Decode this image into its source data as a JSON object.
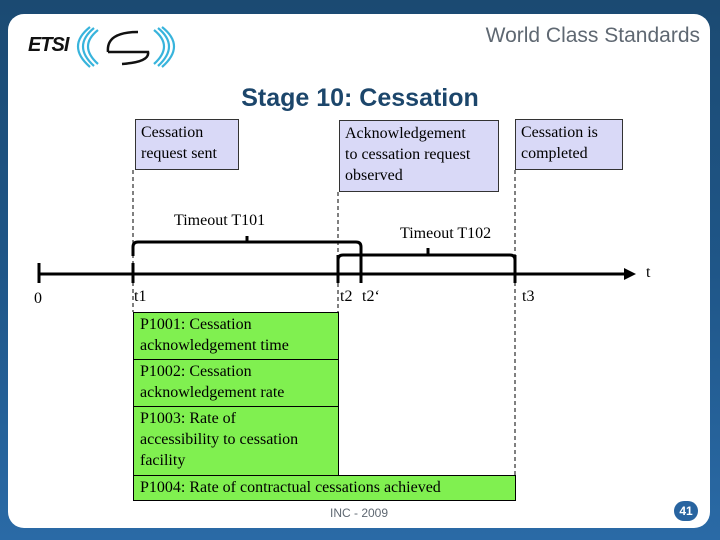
{
  "header": {
    "logo_text": "ETSI",
    "tagline": "World Class Standards"
  },
  "title": "Stage 10: Cessation",
  "events": [
    {
      "id": "t1",
      "label": "Cessation\nrequest sent"
    },
    {
      "id": "t2",
      "label": "Acknowledgement\nto cessation request\nobserved"
    },
    {
      "id": "t3",
      "label": "Cessation is\ncompleted"
    }
  ],
  "timeouts": [
    {
      "label": "Timeout T101",
      "from": "t1",
      "to": "t2'"
    },
    {
      "label": "Timeout T102",
      "from": "t2",
      "to": "t3"
    }
  ],
  "axis": {
    "label": "t",
    "ticks": [
      "0",
      "t1",
      "t2",
      "t2‘",
      "t3"
    ]
  },
  "metrics": [
    {
      "id": "P1001",
      "label": "P1001: Cessation\nacknowledgement time"
    },
    {
      "id": "P1002",
      "label": "P1002: Cessation\nacknowledgement rate"
    },
    {
      "id": "P1003",
      "label": "P1003: Rate of\naccessibility to cessation\nfacility"
    },
    {
      "id": "P1004",
      "label": "P1004: Rate of  contractual  cessations achieved"
    }
  ],
  "footer": {
    "text": "INC - 2009",
    "page_number": "41"
  },
  "colors": {
    "frame": "#1f5688",
    "title": "#1c466b",
    "event_box": "#d9d9f7",
    "metric_box": "#80f050",
    "logo_cyan": "#38b4dc"
  }
}
